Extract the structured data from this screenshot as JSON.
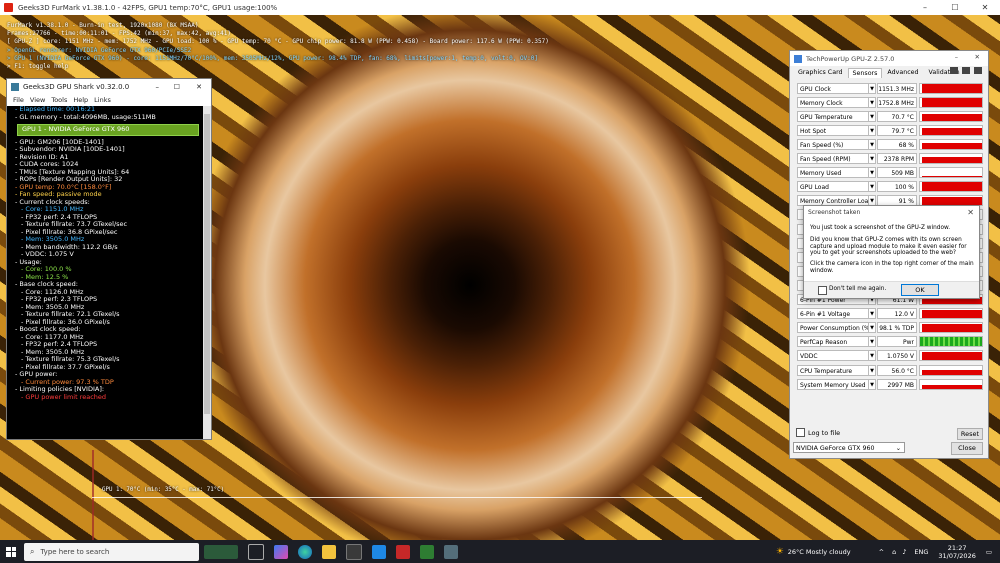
{
  "furmark": {
    "window_title": "Geeks3D FurMark v1.38.1.0 - 42FPS, GPU1 temp:70°C, GPU1 usage:100%",
    "overlay_lines": [
      {
        "text": "FurMark v1.38.1.0 - Burn-in test, 1920x1080 (8X MSAA)",
        "cls": ""
      },
      {
        "text": "Frames:27766 - time:00:11:01 - FPS:42 (min:37, max:42, avg:41)",
        "cls": ""
      },
      {
        "text": "[ GPU-Z ] core: 1151 MHz - mem: 1752 MHz - GPU load: 100 % - GPU temp: 70 °C - GPU chip power: 81.8 W (PPW: 0.458) - Board power: 117.6 W (PPW: 0.357)",
        "cls": ""
      },
      {
        "text": "> OpenGL renderer: NVIDIA GeForce GTX 960/PCIe/SSE2",
        "cls": "cyan"
      },
      {
        "text": "> GPU 1 (NVIDIA GeForce GTX 960) - core: 1151MHz/70°C/100%, mem: 3505MHz/12%, GPU power: 98.4% TDP, fan: 68%, limits[power:1, temp:0, volt:0, OV:0]",
        "cls": "cyan"
      },
      {
        "text": "> F1: toggle help",
        "cls": ""
      }
    ],
    "graph_label": "GPU 1: 70°C (min: 35°C - max: 71°C)"
  },
  "gpushark": {
    "title": "Geeks3D GPU Shark v0.32.0.0",
    "menu": [
      "File",
      "View",
      "Tools",
      "Help",
      "Links"
    ],
    "lines_top": [
      {
        "t": "- Elapsed time: 00:16:21",
        "c": "c-white"
      },
      {
        "t": "- GL memory - total:4096MB, usage:511MB",
        "c": "c-white"
      }
    ],
    "gpu_header": "GPU 1 - NVIDIA GeForce GTX 960",
    "lines": [
      {
        "t": "- GPU: GM206 [10DE-1401]",
        "c": "c-white",
        "i": 0
      },
      {
        "t": "- Subvendor: NVIDIA [10DE-1401]",
        "c": "c-white",
        "i": 0
      },
      {
        "t": "- Revision ID: A1",
        "c": "c-white",
        "i": 0
      },
      {
        "t": "- CUDA cores: 1024",
        "c": "c-white",
        "i": 0
      },
      {
        "t": "- TMUs [Texture Mapping Units]: 64",
        "c": "c-white",
        "i": 0
      },
      {
        "t": "- ROPs [Render Output Units]: 32",
        "c": "c-white",
        "i": 0
      },
      {
        "t": "- GPU temp: 70.0°C [158.0°F]",
        "c": "c-orange",
        "i": 0
      },
      {
        "t": "- Fan speed: passive mode",
        "c": "c-yellow",
        "i": 0
      },
      {
        "t": "- Current clock speeds:",
        "c": "c-white",
        "i": 0
      },
      {
        "t": "- Core: 1151.0 MHz",
        "c": "c-cyan",
        "i": 1
      },
      {
        "t": "- FP32 perf: 2.4 TFLOPS",
        "c": "c-white",
        "i": 1
      },
      {
        "t": "- Texture fillrate: 73.7 GTexel/sec",
        "c": "c-white",
        "i": 1
      },
      {
        "t": "- Pixel fillrate: 36.8 GPixel/sec",
        "c": "c-white",
        "i": 1
      },
      {
        "t": "- Mem: 3505.0 MHz",
        "c": "c-cyan",
        "i": 1
      },
      {
        "t": "- Mem bandwidth: 112.2 GB/s",
        "c": "c-white",
        "i": 1
      },
      {
        "t": "- VDDC: 1.075 V",
        "c": "c-white",
        "i": 1
      },
      {
        "t": "- Usage:",
        "c": "c-white",
        "i": 0
      },
      {
        "t": "- Core: 100.0 %",
        "c": "c-green",
        "i": 1
      },
      {
        "t": "- Mem: 12.5 %",
        "c": "c-green",
        "i": 1
      },
      {
        "t": "- Base clock speed:",
        "c": "c-white",
        "i": 0
      },
      {
        "t": "- Core: 1126.0 MHz",
        "c": "c-white",
        "i": 1
      },
      {
        "t": "- FP32 perf: 2.3 TFLOPS",
        "c": "c-white",
        "i": 1
      },
      {
        "t": "- Mem: 3505.0 MHz",
        "c": "c-white",
        "i": 1
      },
      {
        "t": "- Texture fillrate: 72.1 GTexel/s",
        "c": "c-white",
        "i": 1
      },
      {
        "t": "- Pixel fillrate: 36.0 GPixel/s",
        "c": "c-white",
        "i": 1
      },
      {
        "t": "- Boost clock speed:",
        "c": "c-white",
        "i": 0
      },
      {
        "t": "- Core: 1177.0 MHz",
        "c": "c-white",
        "i": 1
      },
      {
        "t": "- FP32 perf: 2.4 TFLOPS",
        "c": "c-white",
        "i": 1
      },
      {
        "t": "- Mem: 3505.0 MHz",
        "c": "c-white",
        "i": 1
      },
      {
        "t": "- Texture fillrate: 75.3 GTexel/s",
        "c": "c-white",
        "i": 1
      },
      {
        "t": "- Pixel fillrate: 37.7 GPixel/s",
        "c": "c-white",
        "i": 1
      },
      {
        "t": "- GPU power:",
        "c": "c-white",
        "i": 0
      },
      {
        "t": "- Current power: 97.3 % TDP",
        "c": "c-orange",
        "i": 1
      },
      {
        "t": "- Limiting policies [NVIDIA]:",
        "c": "c-white",
        "i": 0
      },
      {
        "t": "- GPU power limit reached",
        "c": "c-red",
        "i": 1
      }
    ]
  },
  "gpuz": {
    "title": "TechPowerUp GPU-Z 2.57.0",
    "tabs": [
      "Graphics Card",
      "Sensors",
      "Advanced",
      "Validation"
    ],
    "active_tab": "Sensors",
    "sensors": [
      {
        "label": "GPU Clock",
        "value": "1151.3 MHz",
        "fill": 0.95
      },
      {
        "label": "Memory Clock",
        "value": "1752.8 MHz",
        "fill": 0.95
      },
      {
        "label": "GPU Temperature",
        "value": "70.7 °C",
        "fill": 0.7
      },
      {
        "label": "Hot Spot",
        "value": "79.7 °C",
        "fill": 0.8
      },
      {
        "label": "Fan Speed (%)",
        "value": "68 %",
        "fill": 0.68
      },
      {
        "label": "Fan Speed (RPM)",
        "value": "2378 RPM",
        "fill": 0.7
      },
      {
        "label": "Memory Used",
        "value": "509 MB",
        "fill": 0.12
      },
      {
        "label": "GPU Load",
        "value": "100 %",
        "fill": 1.0
      },
      {
        "label": "Memory Controller Load",
        "value": "91 %",
        "fill": 0.91
      },
      {
        "label": "",
        "value": "",
        "fill": 0
      },
      {
        "label": "",
        "value": "",
        "fill": 0
      },
      {
        "label": "",
        "value": "",
        "fill": 0
      },
      {
        "label": "",
        "value": "",
        "fill": 0
      },
      {
        "label": "",
        "value": "",
        "fill": 0
      },
      {
        "label": "",
        "value": "",
        "fill": 0
      },
      {
        "label": "6-Pin #1 Power",
        "value": "61.1 W",
        "fill": 0.75
      },
      {
        "label": "6-Pin #1 Voltage",
        "value": "12.0 V",
        "fill": 0.95
      },
      {
        "label": "Power Consumption (%)",
        "value": "98.1 % TDP",
        "fill": 0.95
      },
      {
        "label": "PerfCap Reason",
        "value": "Pwr",
        "fill": 1.0,
        "green": true
      },
      {
        "label": "VDDC",
        "value": "1.0750 V",
        "fill": 0.9
      },
      {
        "label": "CPU Temperature",
        "value": "56.0 °C",
        "fill": 0.55
      },
      {
        "label": "System Memory Used",
        "value": "2997 MB",
        "fill": 0.35
      }
    ],
    "log_label": "Log to file",
    "reset_label": "Reset",
    "device": "NVIDIA GeForce GTX 960",
    "close_label": "Close"
  },
  "dialog": {
    "title": "Screenshot taken",
    "line1": "You just took a screenshot of the GPU-Z window.",
    "line2": "Did you know that GPU-Z comes with its own screen capture and upload module to make it even easier for you to get your screenshots uploaded to the web?",
    "line3": "Click the camera icon in the top right corner of the main window.",
    "check_label": "Don't tell me again.",
    "ok_label": "OK"
  },
  "taskbar": {
    "search_placeholder": "Type here to search",
    "weather": "26°C  Mostly cloudy",
    "lang": "ENG",
    "time": "21:27",
    "date": "31/07/2026"
  },
  "colors": {
    "accent_red": "#e00000",
    "gpu_green": "#6aa321",
    "taskbar": "#1c1e25"
  }
}
